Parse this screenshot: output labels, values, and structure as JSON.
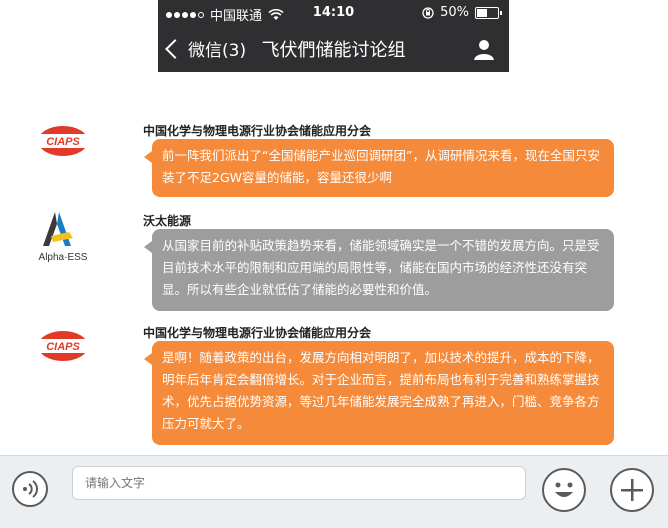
{
  "status_bar": {
    "carrier": "中国联通",
    "time": "14:10",
    "battery": "50%",
    "battery_level": 0.5
  },
  "nav": {
    "back_label": "微信(3)",
    "title": "飞伏們储能讨论组"
  },
  "messages": [
    {
      "sender": "中国化学与物理电源行业协会储能应用分会",
      "avatar_text": "CIAPS",
      "text": "前一阵我们派出了“全国储能产业巡回调研团”，从调研情况来看，现在全国只安装了不足2GW容量的储能，容量还很少啊",
      "color": "#f48a3a"
    },
    {
      "sender": "沃太能源",
      "avatar_text": "Alpha·ESS",
      "text": "从国家目前的补贴政策趋势来看，储能领域确实是一个不错的发展方向。只是受目前技术水平的限制和应用端的局限性等，储能在国内市场的经济性还没有突显。所以有些企业就低估了储能的必要性和价值。",
      "color": "#9d9d9d"
    },
    {
      "sender": "中国化学与物理电源行业协会储能应用分会",
      "avatar_text": "CIAPS",
      "text": "是啊！随着政策的出台，发展方向相对明朗了，加以技术的提升，成本的下降，明年后年肯定会翻倍增长。对于企业而言，提前布局也有利于完善和熟练掌握技术，优先占据优势资源，等过几年储能发展完全成熟了再进入，门槛、竞争各方压力可就大了。",
      "color": "#f48a3a"
    }
  ],
  "input": {
    "placeholder": "请输入文字"
  },
  "icons": {
    "voice": "voice-icon",
    "emoji": "emoji-icon",
    "add": "plus-icon",
    "profile": "person-icon",
    "back": "chevron-left-icon"
  }
}
